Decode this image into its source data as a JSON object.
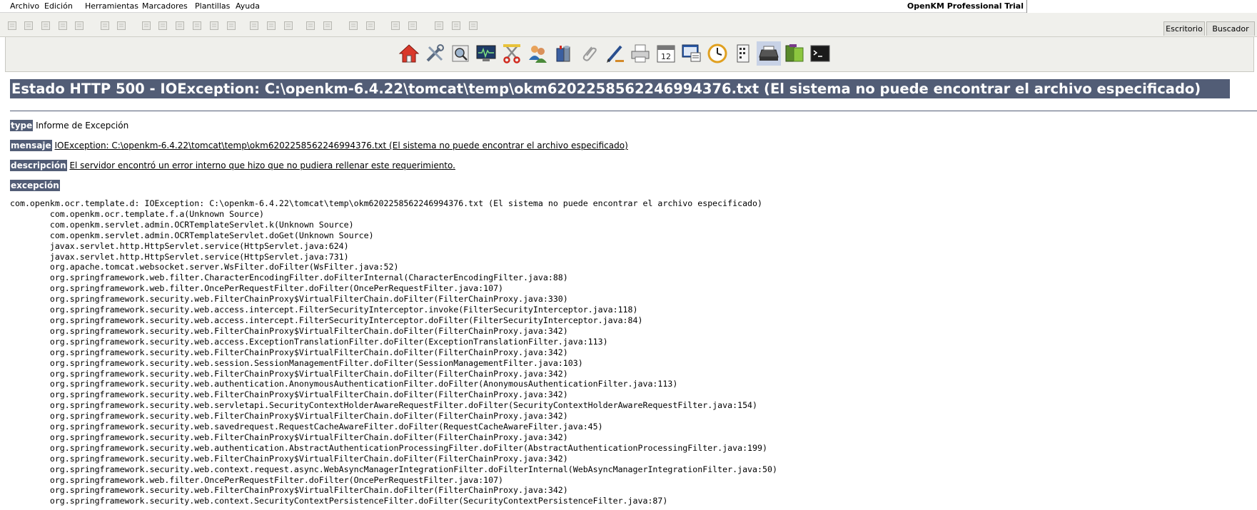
{
  "menu": {
    "items": [
      "Archivo",
      "Edición",
      "Herramientas",
      "Marcadores",
      "Plantillas",
      "Ayuda"
    ],
    "product": "OpenKM Professional Trial",
    "search_value": ""
  },
  "tabs": [
    "Escritorio",
    "Buscador"
  ],
  "toolbar_icons": [
    "home-icon",
    "tools-icon",
    "search-icon",
    "monitor-icon",
    "scissors-icon",
    "users-icon",
    "database-icon",
    "paperclip-icon",
    "pen-icon",
    "printer-icon",
    "calendar-icon",
    "workflow-icon",
    "clock-icon",
    "list-icon",
    "scanner-icon",
    "folder-icon",
    "terminal-icon"
  ],
  "calendar_day": "12",
  "error": {
    "title": "Estado HTTP 500 - IOException: C:\\openkm-6.4.22\\tomcat\\temp\\okm6202258562246994376.txt (El sistema no puede encontrar el archivo especificado)",
    "type_label": "type",
    "type_value": "Informe de Excepción",
    "mensaje_label": "mensaje",
    "mensaje_value": "IOException: C:\\openkm-6.4.22\\tomcat\\temp\\okm6202258562246994376.txt (El sistema no puede encontrar el archivo especificado)",
    "descripcion_label": "descripción",
    "descripcion_value": "El servidor encontró un error interno que hizo que no pudiera rellenar este requerimiento.",
    "excepcion_label": "excepción",
    "stacktrace": "com.openkm.ocr.template.d: IOException: C:\\openkm-6.4.22\\tomcat\\temp\\okm6202258562246994376.txt (El sistema no puede encontrar el archivo especificado)\n\tcom.openkm.ocr.template.f.a(Unknown Source)\n\tcom.openkm.servlet.admin.OCRTemplateServlet.k(Unknown Source)\n\tcom.openkm.servlet.admin.OCRTemplateServlet.doGet(Unknown Source)\n\tjavax.servlet.http.HttpServlet.service(HttpServlet.java:624)\n\tjavax.servlet.http.HttpServlet.service(HttpServlet.java:731)\n\torg.apache.tomcat.websocket.server.WsFilter.doFilter(WsFilter.java:52)\n\torg.springframework.web.filter.CharacterEncodingFilter.doFilterInternal(CharacterEncodingFilter.java:88)\n\torg.springframework.web.filter.OncePerRequestFilter.doFilter(OncePerRequestFilter.java:107)\n\torg.springframework.security.web.FilterChainProxy$VirtualFilterChain.doFilter(FilterChainProxy.java:330)\n\torg.springframework.security.web.access.intercept.FilterSecurityInterceptor.invoke(FilterSecurityInterceptor.java:118)\n\torg.springframework.security.web.access.intercept.FilterSecurityInterceptor.doFilter(FilterSecurityInterceptor.java:84)\n\torg.springframework.security.web.FilterChainProxy$VirtualFilterChain.doFilter(FilterChainProxy.java:342)\n\torg.springframework.security.web.access.ExceptionTranslationFilter.doFilter(ExceptionTranslationFilter.java:113)\n\torg.springframework.security.web.FilterChainProxy$VirtualFilterChain.doFilter(FilterChainProxy.java:342)\n\torg.springframework.security.web.session.SessionManagementFilter.doFilter(SessionManagementFilter.java:103)\n\torg.springframework.security.web.FilterChainProxy$VirtualFilterChain.doFilter(FilterChainProxy.java:342)\n\torg.springframework.security.web.authentication.AnonymousAuthenticationFilter.doFilter(AnonymousAuthenticationFilter.java:113)\n\torg.springframework.security.web.FilterChainProxy$VirtualFilterChain.doFilter(FilterChainProxy.java:342)\n\torg.springframework.security.web.servletapi.SecurityContextHolderAwareRequestFilter.doFilter(SecurityContextHolderAwareRequestFilter.java:154)\n\torg.springframework.security.web.FilterChainProxy$VirtualFilterChain.doFilter(FilterChainProxy.java:342)\n\torg.springframework.security.web.savedrequest.RequestCacheAwareFilter.doFilter(RequestCacheAwareFilter.java:45)\n\torg.springframework.security.web.FilterChainProxy$VirtualFilterChain.doFilter(FilterChainProxy.java:342)\n\torg.springframework.security.web.authentication.AbstractAuthenticationProcessingFilter.doFilter(AbstractAuthenticationProcessingFilter.java:199)\n\torg.springframework.security.web.FilterChainProxy$VirtualFilterChain.doFilter(FilterChainProxy.java:342)\n\torg.springframework.security.web.context.request.async.WebAsyncManagerIntegrationFilter.doFilterInternal(WebAsyncManagerIntegrationFilter.java:50)\n\torg.springframework.web.filter.OncePerRequestFilter.doFilter(OncePerRequestFilter.java:107)\n\torg.springframework.security.web.FilterChainProxy$VirtualFilterChain.doFilter(FilterChainProxy.java:342)\n\torg.springframework.security.web.context.SecurityContextPersistenceFilter.doFilter(SecurityContextPersistenceFilter.java:87)"
  },
  "colors": {
    "label_bg": "#525d76",
    "toolbar_bg": "#efefeb"
  }
}
